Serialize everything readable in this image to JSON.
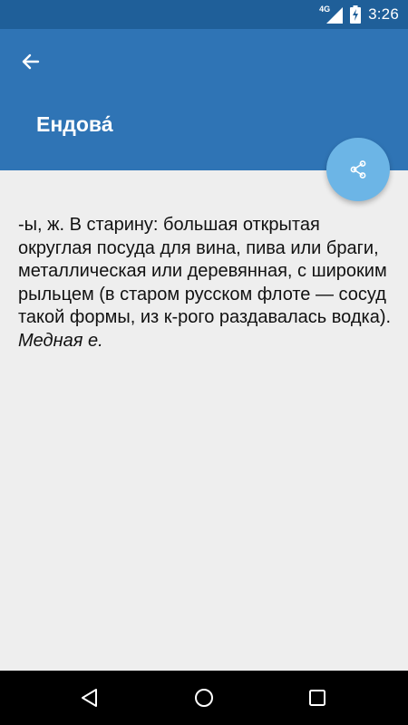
{
  "status_bar": {
    "network_type": "4G",
    "time": "3:26",
    "icons": [
      "signal-icon",
      "battery-charging-icon"
    ]
  },
  "app_bar": {
    "title": "Ендова́",
    "back_icon": "arrow-back-icon",
    "background_color": "#2f74b5"
  },
  "share_button": {
    "icon": "share-icon",
    "color": "#6cb5e6"
  },
  "definition": {
    "text": "-ы, ж. В старину: большая открытая округлая посуда для вина, пива или браги, металлическая или деревянная, с широким рыльцем (в старом русском флоте — сосуд такой формы, из к-рого раздавалась водка).",
    "example": "Медная е."
  },
  "navigation_bar": {
    "icons": [
      "back-triangle-icon",
      "home-circle-icon",
      "recents-square-icon"
    ]
  }
}
